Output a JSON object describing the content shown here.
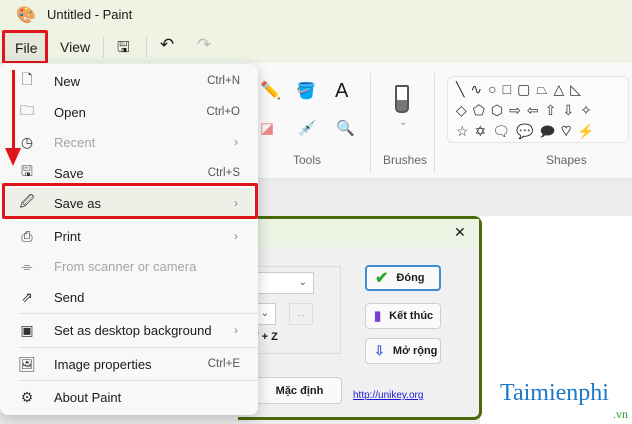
{
  "window": {
    "title": "Untitled - Paint"
  },
  "toolbar": {
    "file": "File",
    "view": "View"
  },
  "ribbon": {
    "groups": {
      "tools": "Tools",
      "brushes": "Brushes",
      "shapes": "Shapes"
    },
    "shapes_rows": [
      "╲∿○□▢⏢△◺",
      "◇⬠⬡⇨⇦⇧⇩✧",
      "☆✡🗨💬🗩♡⚡"
    ]
  },
  "menu": {
    "items": [
      {
        "label": "New",
        "shortcut": "Ctrl+N",
        "icon": "new-file-icon"
      },
      {
        "label": "Open",
        "shortcut": "Ctrl+O",
        "icon": "folder-icon"
      },
      {
        "label": "Recent",
        "icon": "clock-icon"
      },
      {
        "label": "Save",
        "shortcut": "Ctrl+S",
        "icon": "save-icon"
      },
      {
        "label": "Save as",
        "icon": "save-as-icon"
      },
      {
        "label": "Print",
        "icon": "printer-icon"
      },
      {
        "label": "From scanner or camera",
        "icon": "scanner-icon"
      },
      {
        "label": "Send",
        "icon": "share-icon"
      },
      {
        "label": "Set as desktop background",
        "icon": "desktop-icon"
      },
      {
        "label": "Image properties",
        "shortcut": "Ctrl+E",
        "icon": "image-properties-icon"
      },
      {
        "label": "About Paint",
        "icon": "gear-icon"
      }
    ]
  },
  "dialog": {
    "close": "✕",
    "hotkey": "ALT + Z",
    "ellipsis": "...",
    "buttons": {
      "close": "Đóng",
      "exit": "Kết thúc",
      "expand": "Mở rộng",
      "default": "Mặc định"
    },
    "link": "http://unikey.org"
  },
  "watermark": {
    "brand": "Taimienphi",
    "tld": ".vn"
  },
  "colors": {
    "highlight": "#e0141b",
    "border_green": "#4b6a0c"
  }
}
